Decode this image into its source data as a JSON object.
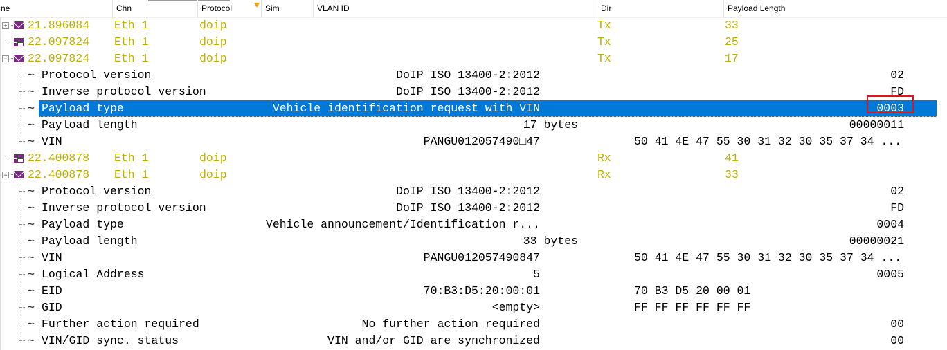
{
  "header": {
    "columns": [
      "ne",
      "Chn",
      "Protocol",
      "Sim",
      "VLAN ID",
      "Dir",
      "Payload Length"
    ]
  },
  "colors": {
    "message_text": "#c0b000",
    "selection": "#0078d7",
    "icon": "#7b2a86",
    "highlight_box": "#e0141e"
  },
  "rows": [
    {
      "type": "message",
      "icon": "envelope-icon",
      "expander": "plus",
      "time": "21.896084",
      "chn": "Eth 1",
      "protocol": "doip",
      "dir": "Tx",
      "length": "33"
    },
    {
      "type": "message",
      "icon": "multi-frame-icon",
      "time": "22.097824",
      "chn": "Eth 1",
      "protocol": "doip",
      "dir": "Tx",
      "length": "25"
    },
    {
      "type": "message",
      "icon": "envelope-icon",
      "expander": "minus",
      "time": "22.097824",
      "chn": "Eth 1",
      "protocol": "doip",
      "dir": "Tx",
      "length": "17"
    },
    {
      "type": "field",
      "name": "Protocol version",
      "value": "DoIP ISO 13400-2:2012",
      "raw": "02"
    },
    {
      "type": "field",
      "name": "Inverse protocol version",
      "value": "DoIP ISO 13400-2:2012",
      "raw": "FD"
    },
    {
      "type": "field",
      "name": "Payload type",
      "value": "Vehicle identification request with VIN",
      "raw": "0003",
      "selected": true
    },
    {
      "type": "field",
      "name": "Payload length",
      "value": "17 bytes",
      "raw": "00000011"
    },
    {
      "type": "field",
      "name": "VIN",
      "value": "PANGU012057490□47",
      "raw": "50 41 4E 47 55 30 31 32 30 35 37 34 ...",
      "last": true
    },
    {
      "type": "message",
      "icon": "multi-frame-icon",
      "time": "22.400878",
      "chn": "Eth 1",
      "protocol": "doip",
      "dir": "Rx",
      "length": "41"
    },
    {
      "type": "message",
      "icon": "envelope-icon",
      "expander": "minus",
      "time": "22.400878",
      "chn": "Eth 1",
      "protocol": "doip",
      "dir": "Rx",
      "length": "33"
    },
    {
      "type": "field",
      "name": "Protocol version",
      "value": "DoIP ISO 13400-2:2012",
      "raw": "02"
    },
    {
      "type": "field",
      "name": "Inverse protocol version",
      "value": "DoIP ISO 13400-2:2012",
      "raw": "FD"
    },
    {
      "type": "field",
      "name": "Payload type",
      "value": "Vehicle announcement/Identification r...",
      "raw": "0004"
    },
    {
      "type": "field",
      "name": "Payload length",
      "value": "33 bytes",
      "raw": "00000021"
    },
    {
      "type": "field",
      "name": "VIN",
      "value": "PANGU012057490847",
      "raw": "50 41 4E 47 55 30 31 32 30 35 37 34 ..."
    },
    {
      "type": "field",
      "name": "Logical Address",
      "value": "5",
      "raw": "0005"
    },
    {
      "type": "field",
      "name": "EID",
      "value": "70:B3:D5:20:00:01",
      "raw": "70 B3 D5 20 00 01"
    },
    {
      "type": "field",
      "name": "GID",
      "value": "<empty>",
      "raw": "FF FF FF FF FF FF"
    },
    {
      "type": "field",
      "name": "Further action required",
      "value": "No further action required",
      "raw": "00"
    },
    {
      "type": "field",
      "name": "VIN/GID sync. status",
      "value": "VIN and/or GID are synchronized",
      "raw": "00"
    }
  ]
}
